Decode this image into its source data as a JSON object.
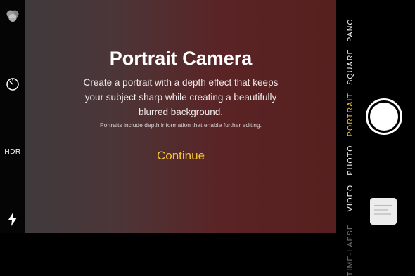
{
  "intro": {
    "title": "Portrait Camera",
    "description": "Create a portrait with a depth effect that keeps your subject sharp while creating a beautifully blurred background.",
    "note": "Portraits include depth information that enable further editing.",
    "continue_label": "Continue"
  },
  "left_controls": {
    "filters_icon": "filters-icon",
    "timer_icon": "timer-icon",
    "hdr_label": "HDR",
    "flash_icon": "flash-icon"
  },
  "modes": [
    {
      "label": "PANO"
    },
    {
      "label": "SQUARE"
    },
    {
      "label": "PORTRAIT",
      "active": true
    },
    {
      "label": "PHOTO"
    },
    {
      "label": "VIDEO"
    },
    {
      "label": "TIME-LAPSE"
    }
  ],
  "colors": {
    "accent": "#f4c430",
    "viewfinder_left": "#3f3a3d",
    "viewfinder_right": "#56201f"
  }
}
